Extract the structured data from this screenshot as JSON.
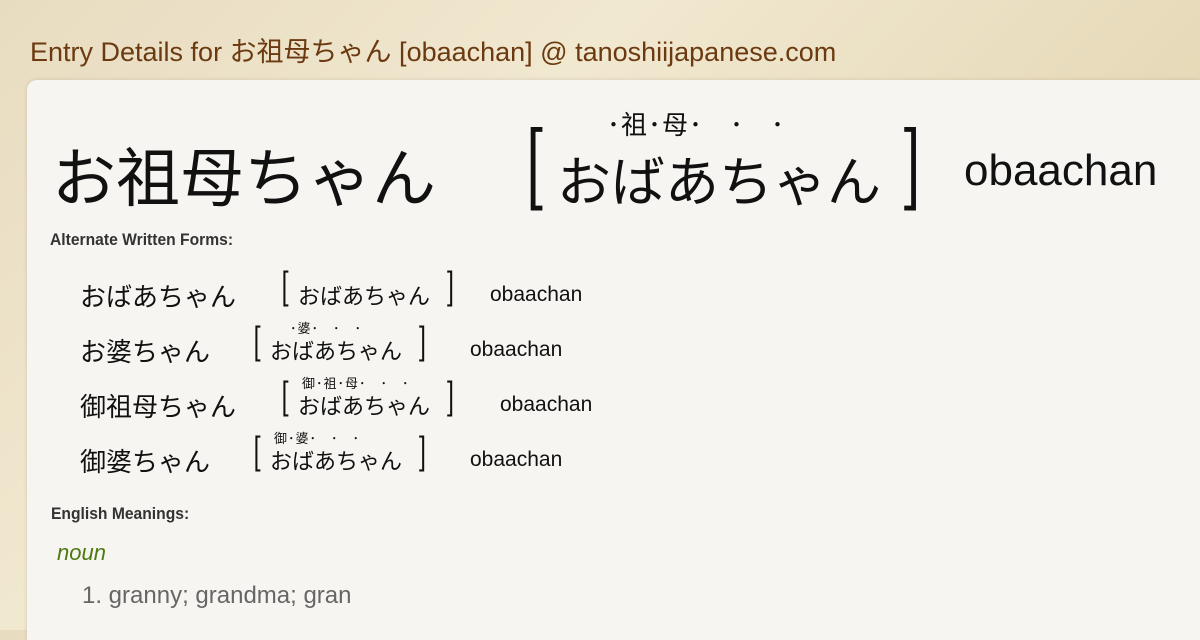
{
  "page_title": "Entry Details for お祖母ちゃん [obaachan] @ tanoshiijapanese.com",
  "entry": {
    "word": "お祖母ちゃん",
    "ruby": "･祖･母･　･　･",
    "reading": "おばあちゃん",
    "romaji": "obaachan"
  },
  "alternate_label": "Alternate Written Forms:",
  "alternates": [
    {
      "word": "おばあちゃん",
      "ruby": "",
      "reading": "おばあちゃん",
      "romaji": "obaachan"
    },
    {
      "word": "お婆ちゃん",
      "ruby": "･婆･　･　･",
      "reading": "おばあちゃん",
      "romaji": "obaachan"
    },
    {
      "word": "御祖母ちゃん",
      "ruby": "御･祖･母･　･　･",
      "reading": "おばあちゃん",
      "romaji": "obaachan"
    },
    {
      "word": "御婆ちゃん",
      "ruby": "御･婆･　･　･",
      "reading": "おばあちゃん",
      "romaji": "obaachan"
    }
  ],
  "meanings_label": "English Meanings:",
  "part_of_speech": "noun",
  "meanings": [
    "1. granny; grandma; gran"
  ]
}
